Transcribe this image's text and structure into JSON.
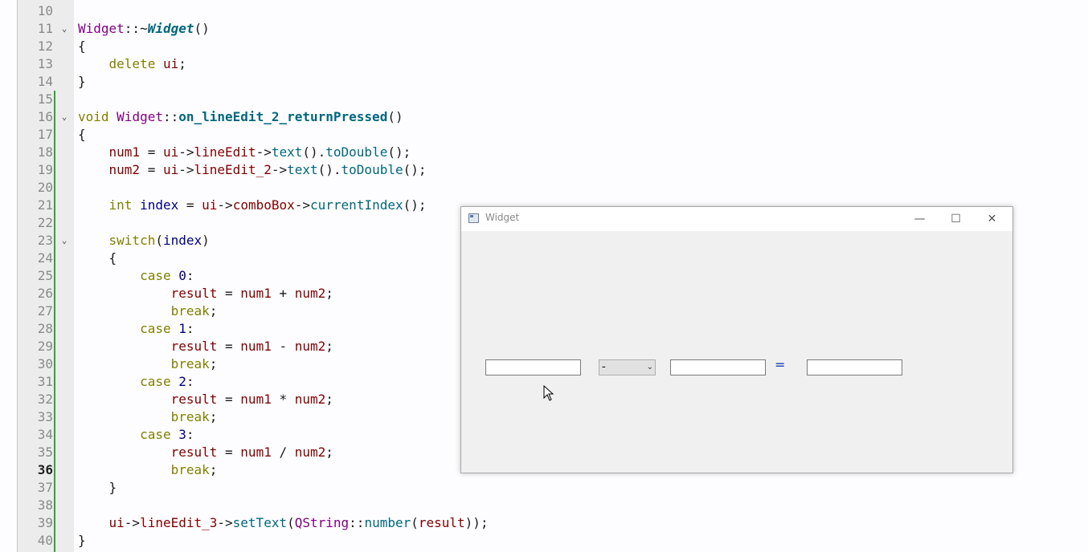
{
  "editor": {
    "lines": [
      {
        "n": "10",
        "fold": "",
        "segs": []
      },
      {
        "n": "11",
        "fold": "⌄",
        "segs": [
          [
            "ty",
            "Widget"
          ],
          [
            "op",
            "::~"
          ],
          [
            "fni",
            "Widget"
          ],
          [
            "op",
            "()"
          ]
        ]
      },
      {
        "n": "12",
        "fold": "",
        "segs": [
          [
            "op",
            "{"
          ]
        ]
      },
      {
        "n": "13",
        "fold": "",
        "segs": [
          [
            "op",
            "    "
          ],
          [
            "kw",
            "delete"
          ],
          [
            "op",
            " "
          ],
          [
            "vr",
            "ui"
          ],
          [
            "op",
            ";"
          ]
        ]
      },
      {
        "n": "14",
        "fold": "",
        "segs": [
          [
            "op",
            "}"
          ]
        ]
      },
      {
        "n": "15",
        "fold": "",
        "segs": []
      },
      {
        "n": "16",
        "fold": "⌄",
        "segs": [
          [
            "kw",
            "void"
          ],
          [
            "op",
            " "
          ],
          [
            "ty",
            "Widget"
          ],
          [
            "op",
            "::"
          ],
          [
            "fnb",
            "on_lineEdit_2_returnPressed"
          ],
          [
            "op",
            "()"
          ]
        ]
      },
      {
        "n": "17",
        "fold": "",
        "segs": [
          [
            "op",
            "{"
          ]
        ]
      },
      {
        "n": "18",
        "fold": "",
        "segs": [
          [
            "op",
            "    "
          ],
          [
            "vr",
            "num1"
          ],
          [
            "op",
            " = "
          ],
          [
            "vr",
            "ui"
          ],
          [
            "op",
            "->"
          ],
          [
            "vr",
            "lineEdit"
          ],
          [
            "op",
            "->"
          ],
          [
            "fn",
            "text"
          ],
          [
            "op",
            "()."
          ],
          [
            "fn",
            "toDouble"
          ],
          [
            "op",
            "();"
          ]
        ]
      },
      {
        "n": "19",
        "fold": "",
        "segs": [
          [
            "op",
            "    "
          ],
          [
            "vr",
            "num2"
          ],
          [
            "op",
            " = "
          ],
          [
            "vr",
            "ui"
          ],
          [
            "op",
            "->"
          ],
          [
            "vr",
            "lineEdit_2"
          ],
          [
            "op",
            "->"
          ],
          [
            "fn",
            "text"
          ],
          [
            "op",
            "()."
          ],
          [
            "fn",
            "toDouble"
          ],
          [
            "op",
            "();"
          ]
        ]
      },
      {
        "n": "20",
        "fold": "",
        "segs": []
      },
      {
        "n": "21",
        "fold": "",
        "segs": [
          [
            "op",
            "    "
          ],
          [
            "kw",
            "int"
          ],
          [
            "op",
            " "
          ],
          [
            "nm",
            "index"
          ],
          [
            "op",
            " = "
          ],
          [
            "vr",
            "ui"
          ],
          [
            "op",
            "->"
          ],
          [
            "vr",
            "comboBox"
          ],
          [
            "op",
            "->"
          ],
          [
            "fn",
            "currentIndex"
          ],
          [
            "op",
            "();"
          ]
        ]
      },
      {
        "n": "22",
        "fold": "",
        "segs": []
      },
      {
        "n": "23",
        "fold": "⌄",
        "segs": [
          [
            "op",
            "    "
          ],
          [
            "kw",
            "switch"
          ],
          [
            "op",
            "("
          ],
          [
            "nm",
            "index"
          ],
          [
            "op",
            ")"
          ]
        ]
      },
      {
        "n": "24",
        "fold": "",
        "segs": [
          [
            "op",
            "    {"
          ]
        ]
      },
      {
        "n": "25",
        "fold": "",
        "segs": [
          [
            "op",
            "        "
          ],
          [
            "kw",
            "case"
          ],
          [
            "op",
            " "
          ],
          [
            "nm",
            "0"
          ],
          [
            "op",
            ":"
          ]
        ]
      },
      {
        "n": "26",
        "fold": "",
        "segs": [
          [
            "op",
            "            "
          ],
          [
            "vr",
            "result"
          ],
          [
            "op",
            " = "
          ],
          [
            "vr",
            "num1"
          ],
          [
            "op",
            " + "
          ],
          [
            "vr",
            "num2"
          ],
          [
            "op",
            ";"
          ]
        ]
      },
      {
        "n": "27",
        "fold": "",
        "segs": [
          [
            "op",
            "            "
          ],
          [
            "kw",
            "break"
          ],
          [
            "op",
            ";"
          ]
        ]
      },
      {
        "n": "28",
        "fold": "",
        "segs": [
          [
            "op",
            "        "
          ],
          [
            "kw",
            "case"
          ],
          [
            "op",
            " "
          ],
          [
            "nm",
            "1"
          ],
          [
            "op",
            ":"
          ]
        ]
      },
      {
        "n": "29",
        "fold": "",
        "segs": [
          [
            "op",
            "            "
          ],
          [
            "vr",
            "result"
          ],
          [
            "op",
            " = "
          ],
          [
            "vr",
            "num1"
          ],
          [
            "op",
            " - "
          ],
          [
            "vr",
            "num2"
          ],
          [
            "op",
            ";"
          ]
        ]
      },
      {
        "n": "30",
        "fold": "",
        "segs": [
          [
            "op",
            "            "
          ],
          [
            "kw",
            "break"
          ],
          [
            "op",
            ";"
          ]
        ]
      },
      {
        "n": "31",
        "fold": "",
        "segs": [
          [
            "op",
            "        "
          ],
          [
            "kw",
            "case"
          ],
          [
            "op",
            " "
          ],
          [
            "nm",
            "2"
          ],
          [
            "op",
            ":"
          ]
        ]
      },
      {
        "n": "32",
        "fold": "",
        "segs": [
          [
            "op",
            "            "
          ],
          [
            "vr",
            "result"
          ],
          [
            "op",
            " = "
          ],
          [
            "vr",
            "num1"
          ],
          [
            "op",
            " * "
          ],
          [
            "vr",
            "num2"
          ],
          [
            "op",
            ";"
          ]
        ]
      },
      {
        "n": "33",
        "fold": "",
        "segs": [
          [
            "op",
            "            "
          ],
          [
            "kw",
            "break"
          ],
          [
            "op",
            ";"
          ]
        ]
      },
      {
        "n": "34",
        "fold": "",
        "segs": [
          [
            "op",
            "        "
          ],
          [
            "kw",
            "case"
          ],
          [
            "op",
            " "
          ],
          [
            "nm",
            "3"
          ],
          [
            "op",
            ":"
          ]
        ]
      },
      {
        "n": "35",
        "fold": "",
        "segs": [
          [
            "op",
            "            "
          ],
          [
            "vr",
            "result"
          ],
          [
            "op",
            " = "
          ],
          [
            "vr",
            "num1"
          ],
          [
            "op",
            " / "
          ],
          [
            "vr",
            "num2"
          ],
          [
            "op",
            ";"
          ]
        ]
      },
      {
        "n": "36",
        "fold": "",
        "current": true,
        "segs": [
          [
            "op",
            "            "
          ],
          [
            "kw",
            "break"
          ],
          [
            "op",
            ";"
          ]
        ]
      },
      {
        "n": "37",
        "fold": "",
        "segs": [
          [
            "op",
            "    }"
          ]
        ]
      },
      {
        "n": "38",
        "fold": "",
        "segs": []
      },
      {
        "n": "39",
        "fold": "",
        "segs": [
          [
            "op",
            "    "
          ],
          [
            "vr",
            "ui"
          ],
          [
            "op",
            "->"
          ],
          [
            "vr",
            "lineEdit_3"
          ],
          [
            "op",
            "->"
          ],
          [
            "fn",
            "setText"
          ],
          [
            "op",
            "("
          ],
          [
            "ty",
            "QString"
          ],
          [
            "op",
            "::"
          ],
          [
            "fn",
            "number"
          ],
          [
            "op",
            "("
          ],
          [
            "vr",
            "result"
          ],
          [
            "op",
            "));"
          ]
        ]
      },
      {
        "n": "40",
        "fold": "",
        "segs": [
          [
            "op",
            "}"
          ]
        ]
      }
    ]
  },
  "widget": {
    "title": "Widget",
    "minimize_icon": "minimize-icon",
    "maximize_icon": "maximize-icon",
    "close_icon": "close-icon",
    "line_edit_1": {
      "value": ""
    },
    "combo": {
      "selected": "-"
    },
    "line_edit_2": {
      "value": ""
    },
    "equals_label": "=",
    "line_edit_3": {
      "value": ""
    }
  }
}
